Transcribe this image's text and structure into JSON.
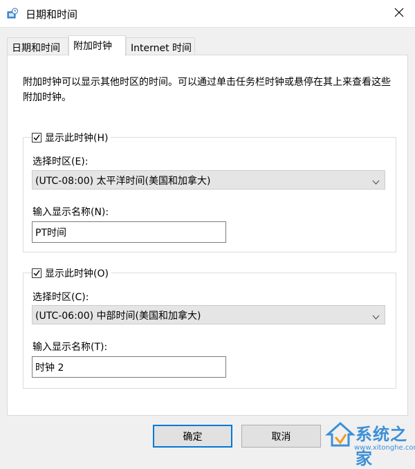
{
  "window": {
    "title": "日期和时间",
    "close_icon": "close-icon"
  },
  "tabs": [
    {
      "label": "日期和时间",
      "active": false
    },
    {
      "label": "附加时钟",
      "active": true
    },
    {
      "label": "Internet 时间",
      "active": false
    }
  ],
  "description": "附加时钟可以显示其他时区的时间。可以通过单击任务栏时钟或悬停在其上来查看这些附加时钟。",
  "clock1": {
    "checkbox_label": "显示此时钟(H)",
    "checked": true,
    "timezone_label": "选择时区(E):",
    "timezone_value": "(UTC-08:00) 太平洋时间(美国和加拿大)",
    "name_label": "输入显示名称(N):",
    "name_value": "PT时间"
  },
  "clock2": {
    "checkbox_label": "显示此时钟(O)",
    "checked": true,
    "timezone_label": "选择时区(C):",
    "timezone_value": "(UTC-06:00) 中部时间(美国和加拿大)",
    "name_label": "输入显示名称(T):",
    "name_value": "时钟 2"
  },
  "buttons": {
    "ok": "确定",
    "cancel": "取消"
  },
  "watermark": {
    "brand": "系统之家",
    "url": "www.xitonghe.com"
  },
  "colors": {
    "accent": "#0078d7",
    "select_bg": "#e5e5e5",
    "watermark": "#3c8fd6"
  }
}
